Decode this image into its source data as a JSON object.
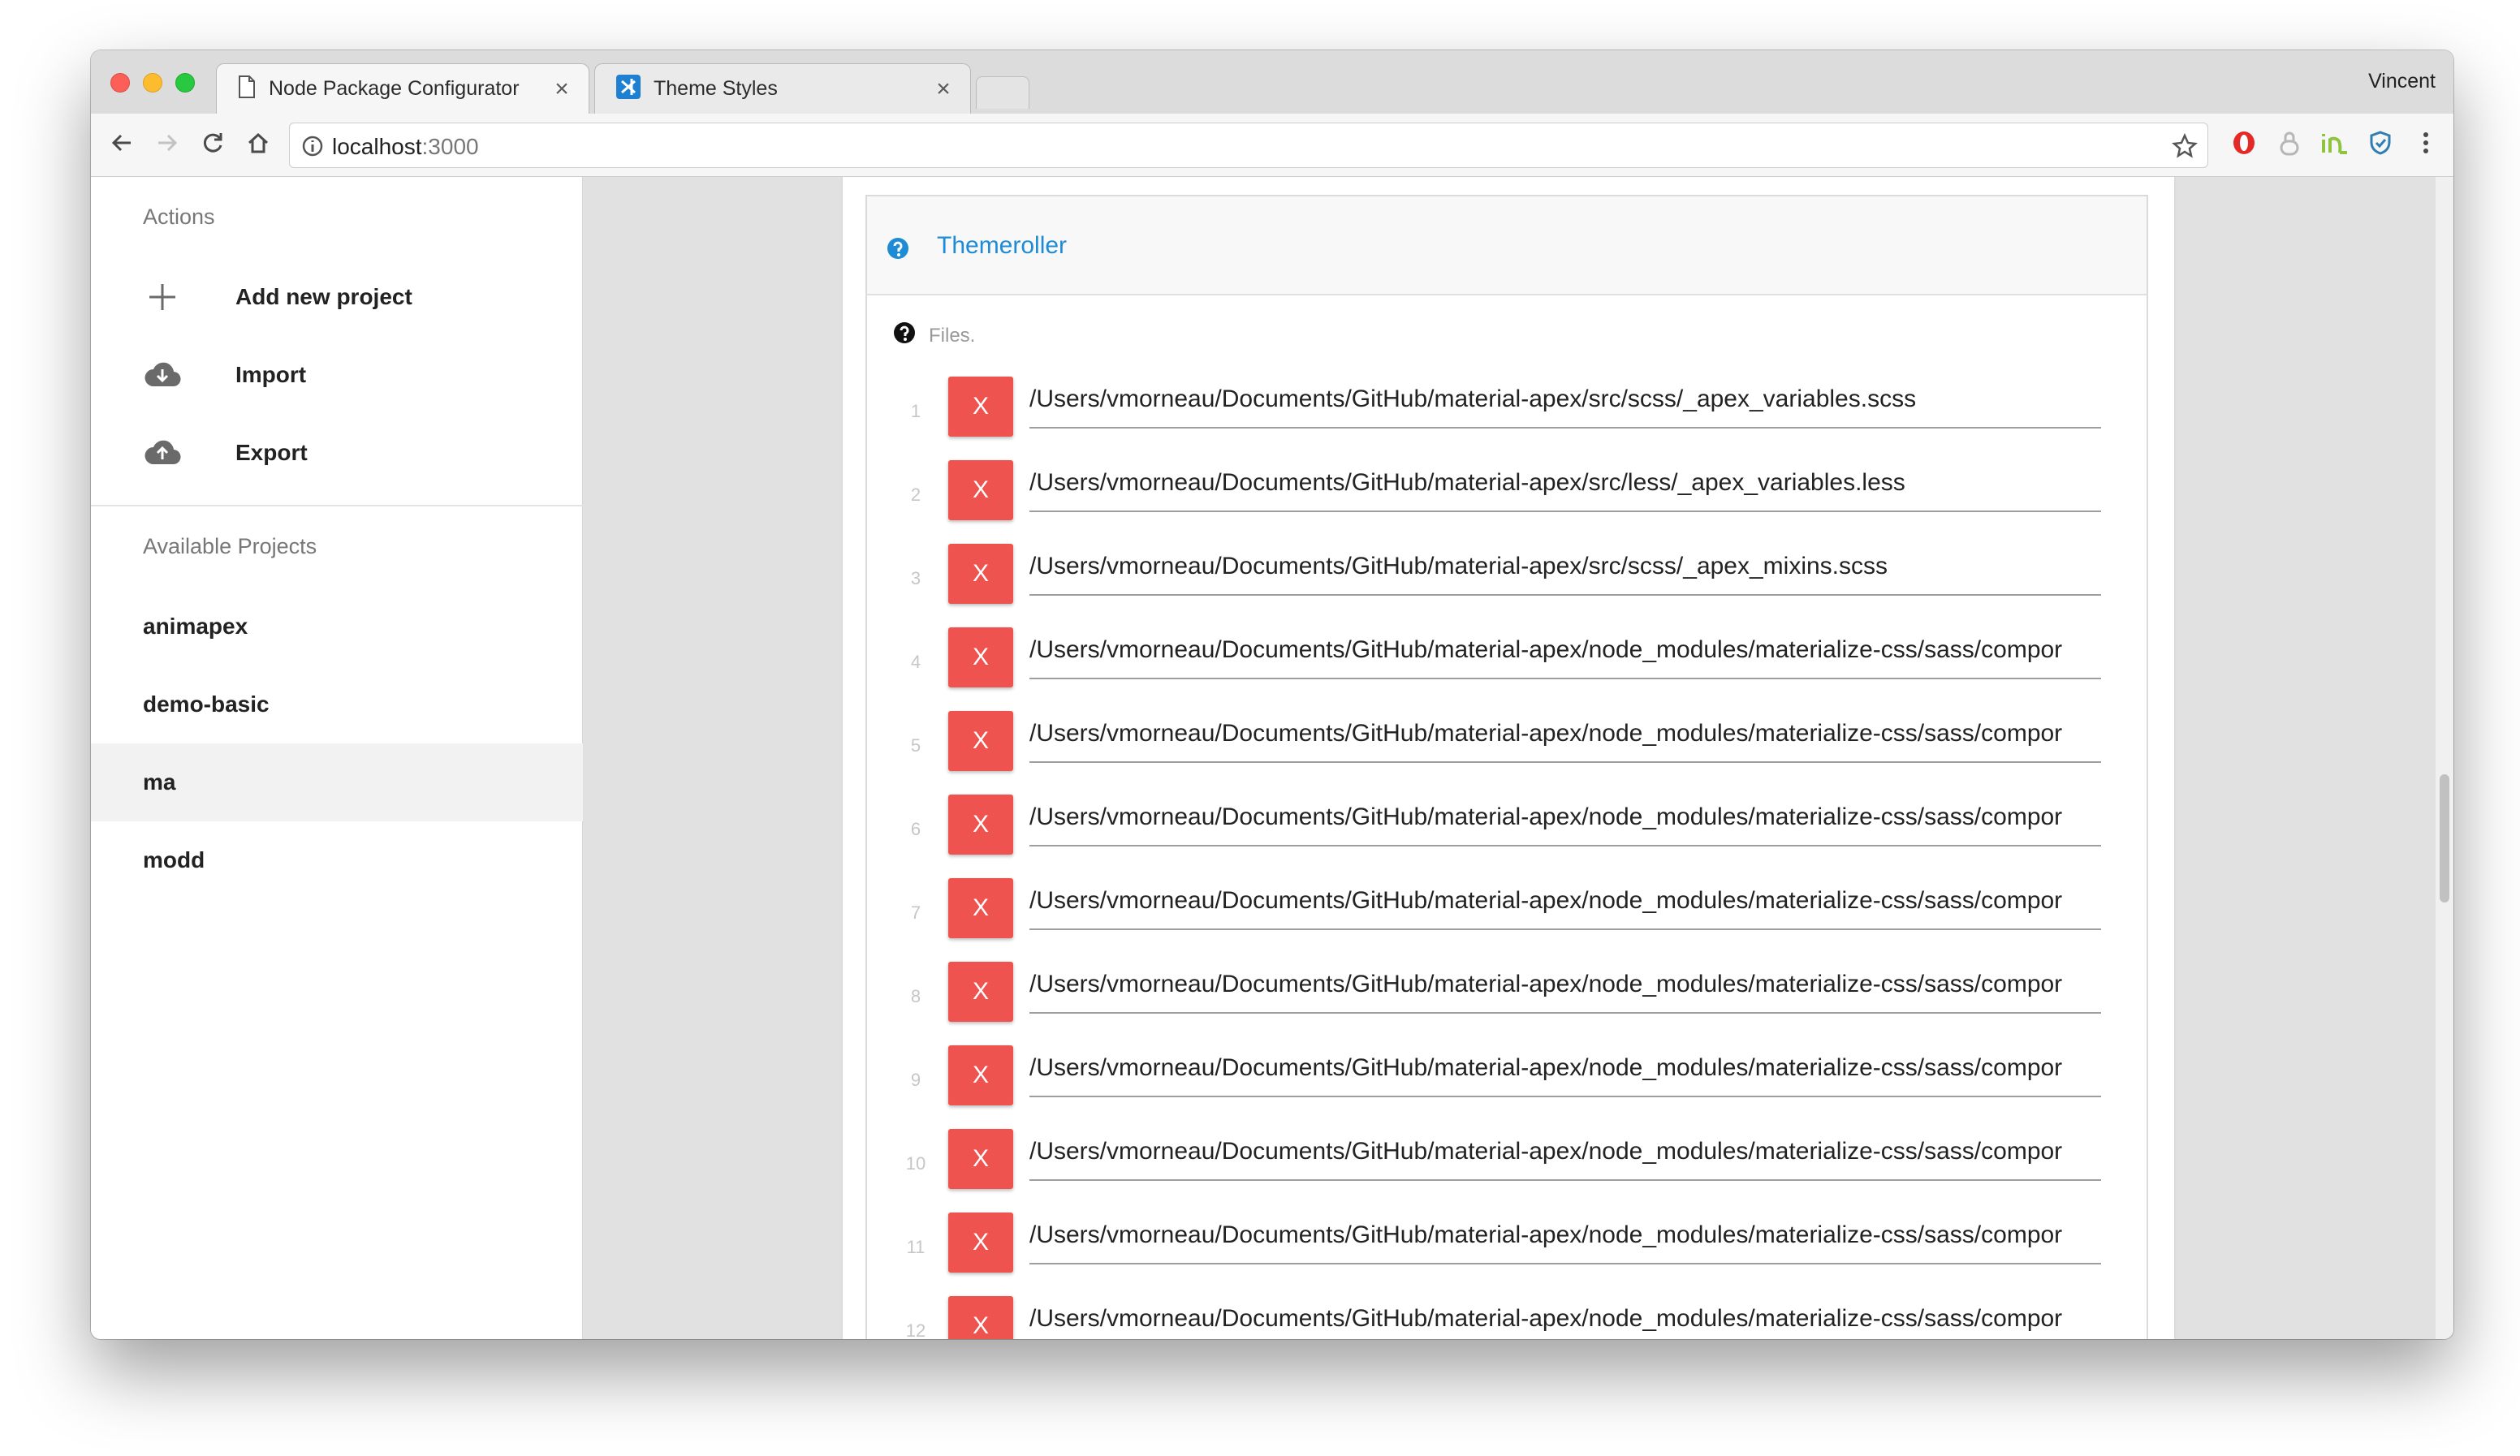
{
  "browser": {
    "tabs": [
      {
        "title": "Node Package Configurator",
        "icon": "document-icon"
      },
      {
        "title": "Theme Styles",
        "icon": "vscode-icon"
      }
    ],
    "close_glyph": "×",
    "profile_name": "Vincent",
    "url_host": "localhost",
    "url_port": ":3000"
  },
  "sidebar": {
    "actions_heading": "Actions",
    "actions": [
      {
        "label": "Add new project",
        "icon": "plus-icon"
      },
      {
        "label": "Import",
        "icon": "cloud-download-icon"
      },
      {
        "label": "Export",
        "icon": "cloud-upload-icon"
      }
    ],
    "projects_heading": "Available Projects",
    "projects": [
      {
        "label": "animapex",
        "selected": false
      },
      {
        "label": "demo-basic",
        "selected": false
      },
      {
        "label": "ma",
        "selected": true
      },
      {
        "label": "modd",
        "selected": false
      }
    ]
  },
  "panel": {
    "title": "Themeroller",
    "files_label": "Files.",
    "delete_label": "X",
    "files": [
      {
        "n": "1",
        "path": "/Users/vmorneau/Documents/GitHub/material-apex/src/scss/_apex_variables.scss"
      },
      {
        "n": "2",
        "path": "/Users/vmorneau/Documents/GitHub/material-apex/src/less/_apex_variables.less"
      },
      {
        "n": "3",
        "path": "/Users/vmorneau/Documents/GitHub/material-apex/src/scss/_apex_mixins.scss"
      },
      {
        "n": "4",
        "path": "/Users/vmorneau/Documents/GitHub/material-apex/node_modules/materialize-css/sass/compor"
      },
      {
        "n": "5",
        "path": "/Users/vmorneau/Documents/GitHub/material-apex/node_modules/materialize-css/sass/compor"
      },
      {
        "n": "6",
        "path": "/Users/vmorneau/Documents/GitHub/material-apex/node_modules/materialize-css/sass/compor"
      },
      {
        "n": "7",
        "path": "/Users/vmorneau/Documents/GitHub/material-apex/node_modules/materialize-css/sass/compor"
      },
      {
        "n": "8",
        "path": "/Users/vmorneau/Documents/GitHub/material-apex/node_modules/materialize-css/sass/compor"
      },
      {
        "n": "9",
        "path": "/Users/vmorneau/Documents/GitHub/material-apex/node_modules/materialize-css/sass/compor"
      },
      {
        "n": "10",
        "path": "/Users/vmorneau/Documents/GitHub/material-apex/node_modules/materialize-css/sass/compor"
      },
      {
        "n": "11",
        "path": "/Users/vmorneau/Documents/GitHub/material-apex/node_modules/materialize-css/sass/compor"
      },
      {
        "n": "12",
        "path": "/Users/vmorneau/Documents/GitHub/material-apex/node_modules/materialize-css/sass/compor"
      }
    ]
  },
  "colors": {
    "delete_button": "#ef5350",
    "link_blue": "#1e8bd6",
    "canvas_gray": "#e1e1e1"
  }
}
